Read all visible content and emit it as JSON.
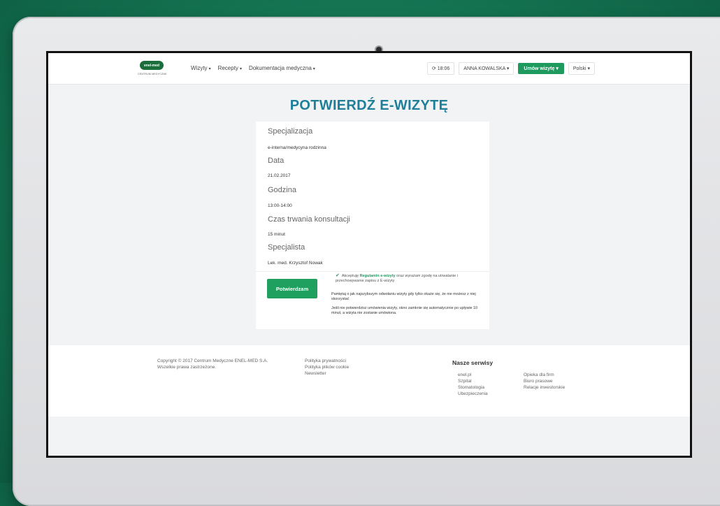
{
  "nav": {
    "logo_text": "enel-med",
    "logo_sub": "CENTRUM MEDYCZNE",
    "menu": [
      {
        "label": "Wizyty"
      },
      {
        "label": "Recepty"
      },
      {
        "label": "Dokumentacja medyczna"
      }
    ],
    "time": "18:06",
    "user": "ANNA KOWALSKA",
    "appointment_button": "Umów wizytę",
    "language": "Polski"
  },
  "page": {
    "title": "POTWIERDŹ E-WIZYTĘ"
  },
  "details": {
    "specialization_label": "Specjalizacja",
    "specialization_value": "e-interna/medycyna rodzinna",
    "date_label": "Data",
    "date_value": "21.02.2017",
    "hour_label": "Godzina",
    "hour_value": "13:00-14:00",
    "duration_label": "Czas trwania konsultacji",
    "duration_value": "15 minut",
    "specialist_label": "Specjalista",
    "specialist_value": "Lek. med. Krzysztof Nowak"
  },
  "confirm": {
    "button": "Potwierdzam",
    "terms_prefix": "Akceptuję",
    "terms_link": "Regulamin e-wizyty",
    "terms_suffix": "oraz wyrażam zgodę na utrwalanie i przechowywanie zapisu z E-wizyty",
    "note1": "Pamiętaj o jak najszybszym odwołaniu wizyty gdy tylko okaże się, że nie możesz z niej skorzystać",
    "note2": "Jeśli nie potwierdzisz umówienia wizyty, okno zamknie się automatycznie po upływie 10 minut, a wizyta nie zostanie umówiona."
  },
  "footer": {
    "copyright": "Copyright © 2017 Centrum Medyczne ENEL-MED S.A.",
    "rights": "Wszelkie prawa zastrzeżone.",
    "links": [
      "Polityka prywatności",
      "Polityka plików cookie",
      "Newsletter"
    ],
    "services_title": "Nasze serwisy",
    "services_col1": [
      "enel.pl",
      "Szpital",
      "Stomatologia",
      "Ubezpieczenia"
    ],
    "services_col2": [
      "Opieka dla firm",
      "Biuro prasowe",
      "Relacje inwestorskie"
    ]
  },
  "colors": {
    "brand_green": "#1f9a5f",
    "title_teal": "#1f7f9a",
    "background_green": "#13704f"
  }
}
